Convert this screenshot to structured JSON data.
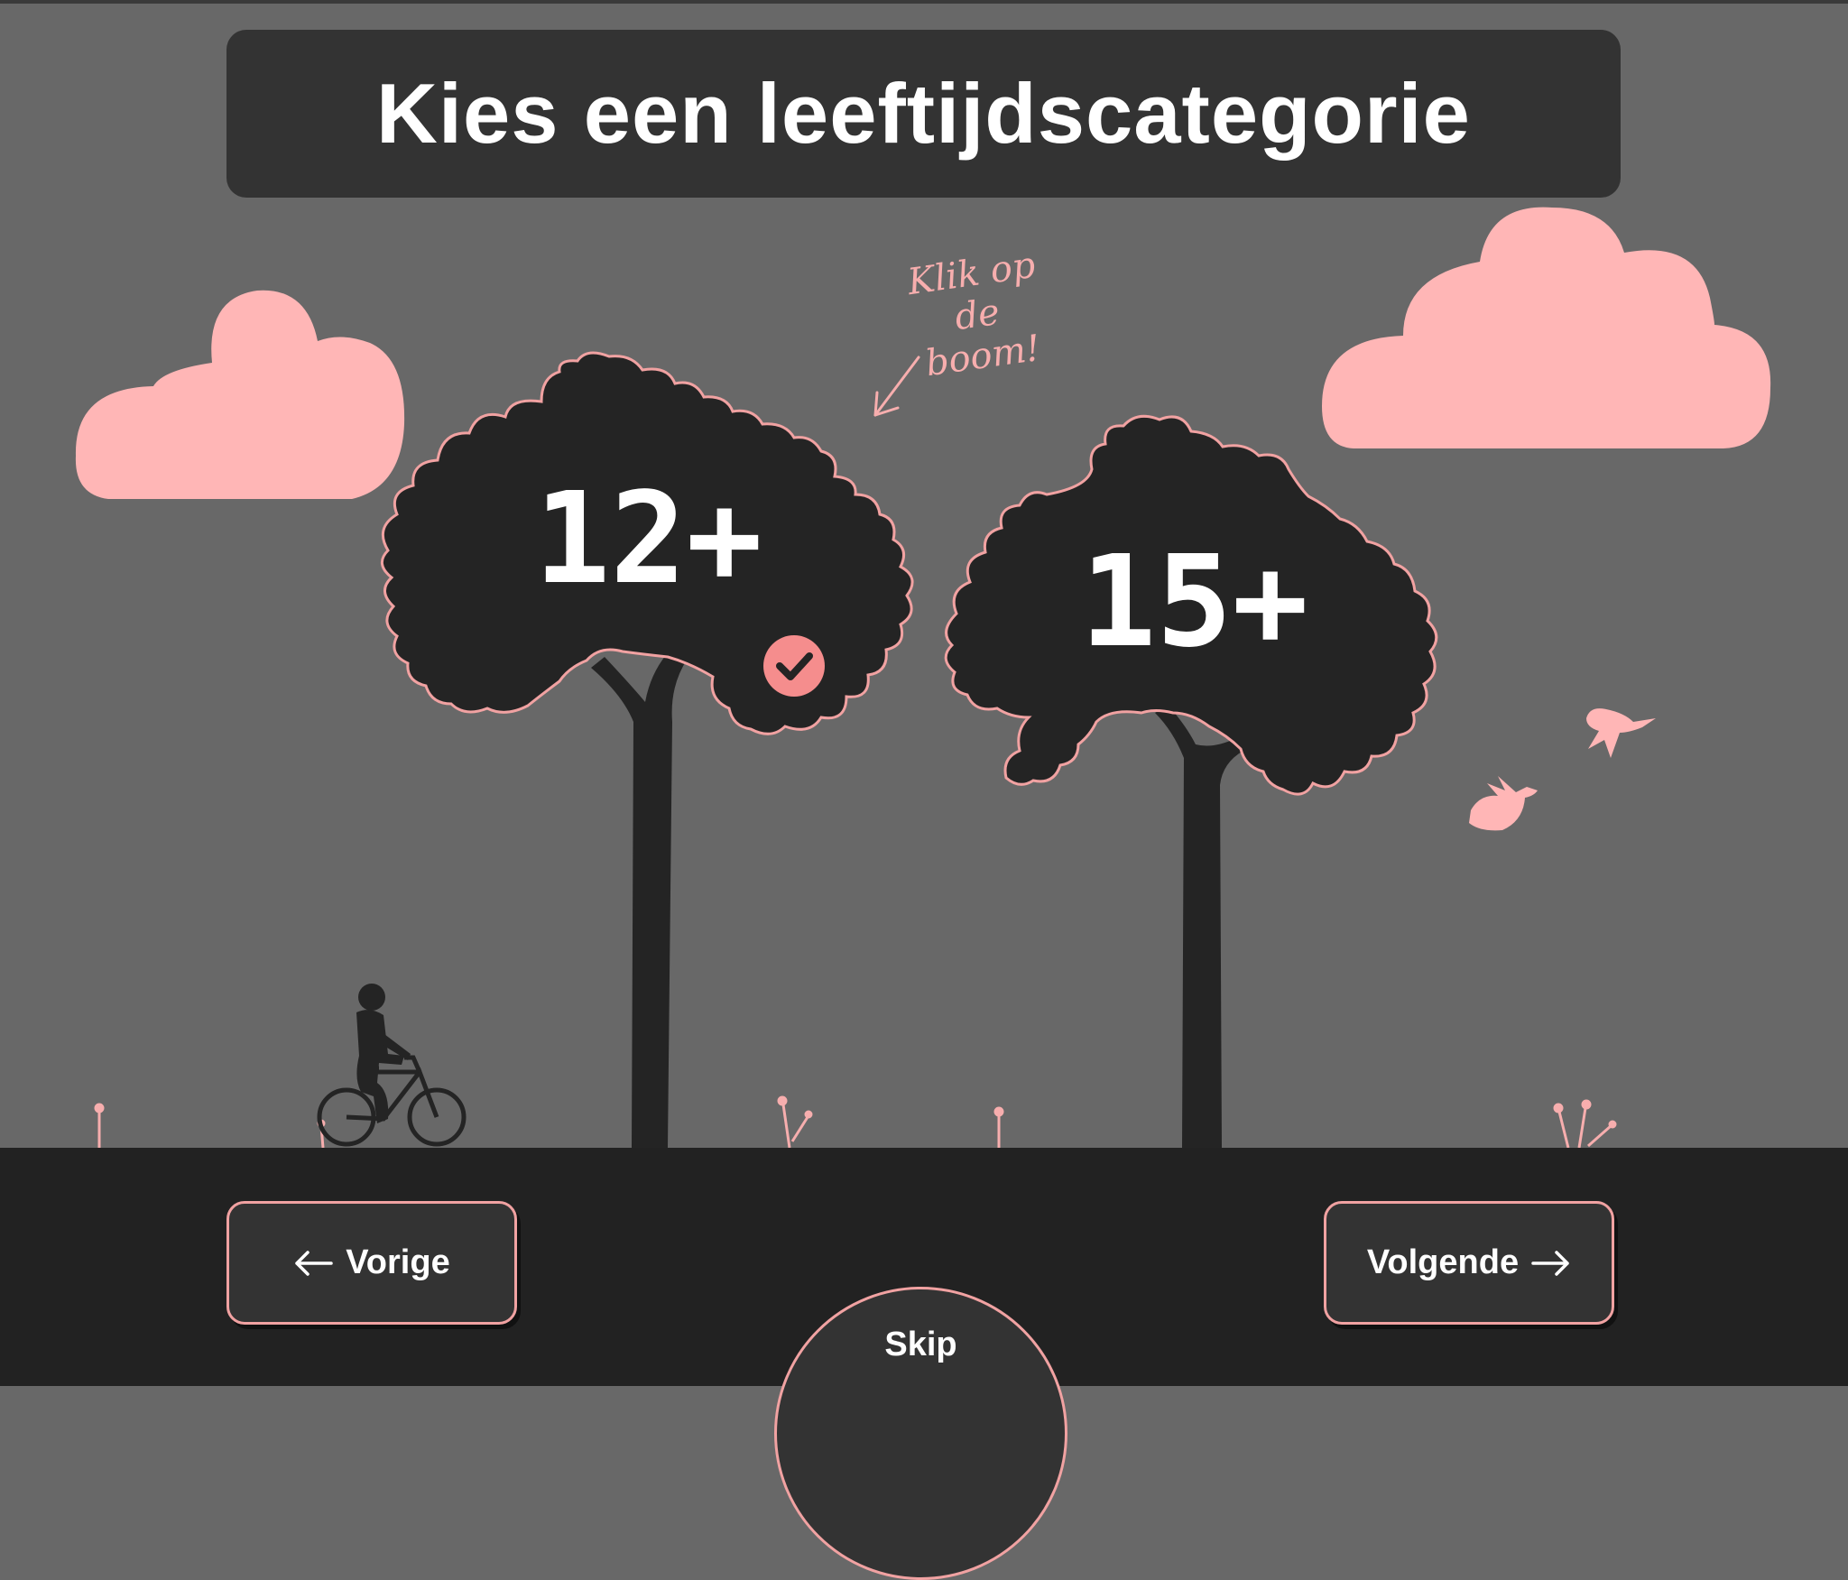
{
  "title": "Kies een leeftijdscategorie",
  "hint": {
    "line1": "Klik op",
    "line2": "de boom!"
  },
  "options": [
    {
      "label": "12+",
      "selected": true
    },
    {
      "label": "15+",
      "selected": false
    }
  ],
  "nav": {
    "prev_label": "Vorige",
    "next_label": "Volgende",
    "skip_label": "Skip"
  },
  "colors": {
    "background": "#686868",
    "panel": "#333333",
    "ground": "#222222",
    "tree": "#242424",
    "accent": "#f7aeae"
  },
  "icons": {
    "prev": "arrow-left-icon",
    "next": "arrow-right-icon",
    "selected": "check-icon"
  }
}
